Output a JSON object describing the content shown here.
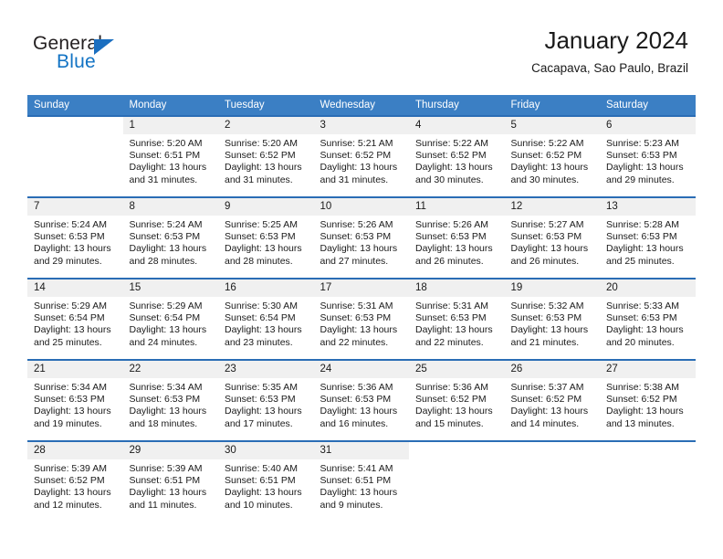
{
  "logo": {
    "word_one": "General",
    "word_two": "Blue",
    "accent_color": "#1273c4",
    "triangle_icon": "triangle-icon"
  },
  "header": {
    "title": "January 2024",
    "subtitle": "Cacapava, Sao Paulo, Brazil"
  },
  "theme": {
    "header_blue": "#3b7fc4",
    "row_border_blue": "#2a6db5",
    "daynum_band": "#f0f0f0"
  },
  "weekdays": [
    "Sunday",
    "Monday",
    "Tuesday",
    "Wednesday",
    "Thursday",
    "Friday",
    "Saturday"
  ],
  "weeks": [
    [
      {
        "day": "",
        "sunrise": "",
        "sunset": "",
        "daylight": ""
      },
      {
        "day": "1",
        "sunrise": "Sunrise: 5:20 AM",
        "sunset": "Sunset: 6:51 PM",
        "daylight": "Daylight: 13 hours and 31 minutes."
      },
      {
        "day": "2",
        "sunrise": "Sunrise: 5:20 AM",
        "sunset": "Sunset: 6:52 PM",
        "daylight": "Daylight: 13 hours and 31 minutes."
      },
      {
        "day": "3",
        "sunrise": "Sunrise: 5:21 AM",
        "sunset": "Sunset: 6:52 PM",
        "daylight": "Daylight: 13 hours and 31 minutes."
      },
      {
        "day": "4",
        "sunrise": "Sunrise: 5:22 AM",
        "sunset": "Sunset: 6:52 PM",
        "daylight": "Daylight: 13 hours and 30 minutes."
      },
      {
        "day": "5",
        "sunrise": "Sunrise: 5:22 AM",
        "sunset": "Sunset: 6:52 PM",
        "daylight": "Daylight: 13 hours and 30 minutes."
      },
      {
        "day": "6",
        "sunrise": "Sunrise: 5:23 AM",
        "sunset": "Sunset: 6:53 PM",
        "daylight": "Daylight: 13 hours and 29 minutes."
      }
    ],
    [
      {
        "day": "7",
        "sunrise": "Sunrise: 5:24 AM",
        "sunset": "Sunset: 6:53 PM",
        "daylight": "Daylight: 13 hours and 29 minutes."
      },
      {
        "day": "8",
        "sunrise": "Sunrise: 5:24 AM",
        "sunset": "Sunset: 6:53 PM",
        "daylight": "Daylight: 13 hours and 28 minutes."
      },
      {
        "day": "9",
        "sunrise": "Sunrise: 5:25 AM",
        "sunset": "Sunset: 6:53 PM",
        "daylight": "Daylight: 13 hours and 28 minutes."
      },
      {
        "day": "10",
        "sunrise": "Sunrise: 5:26 AM",
        "sunset": "Sunset: 6:53 PM",
        "daylight": "Daylight: 13 hours and 27 minutes."
      },
      {
        "day": "11",
        "sunrise": "Sunrise: 5:26 AM",
        "sunset": "Sunset: 6:53 PM",
        "daylight": "Daylight: 13 hours and 26 minutes."
      },
      {
        "day": "12",
        "sunrise": "Sunrise: 5:27 AM",
        "sunset": "Sunset: 6:53 PM",
        "daylight": "Daylight: 13 hours and 26 minutes."
      },
      {
        "day": "13",
        "sunrise": "Sunrise: 5:28 AM",
        "sunset": "Sunset: 6:53 PM",
        "daylight": "Daylight: 13 hours and 25 minutes."
      }
    ],
    [
      {
        "day": "14",
        "sunrise": "Sunrise: 5:29 AM",
        "sunset": "Sunset: 6:54 PM",
        "daylight": "Daylight: 13 hours and 25 minutes."
      },
      {
        "day": "15",
        "sunrise": "Sunrise: 5:29 AM",
        "sunset": "Sunset: 6:54 PM",
        "daylight": "Daylight: 13 hours and 24 minutes."
      },
      {
        "day": "16",
        "sunrise": "Sunrise: 5:30 AM",
        "sunset": "Sunset: 6:54 PM",
        "daylight": "Daylight: 13 hours and 23 minutes."
      },
      {
        "day": "17",
        "sunrise": "Sunrise: 5:31 AM",
        "sunset": "Sunset: 6:53 PM",
        "daylight": "Daylight: 13 hours and 22 minutes."
      },
      {
        "day": "18",
        "sunrise": "Sunrise: 5:31 AM",
        "sunset": "Sunset: 6:53 PM",
        "daylight": "Daylight: 13 hours and 22 minutes."
      },
      {
        "day": "19",
        "sunrise": "Sunrise: 5:32 AM",
        "sunset": "Sunset: 6:53 PM",
        "daylight": "Daylight: 13 hours and 21 minutes."
      },
      {
        "day": "20",
        "sunrise": "Sunrise: 5:33 AM",
        "sunset": "Sunset: 6:53 PM",
        "daylight": "Daylight: 13 hours and 20 minutes."
      }
    ],
    [
      {
        "day": "21",
        "sunrise": "Sunrise: 5:34 AM",
        "sunset": "Sunset: 6:53 PM",
        "daylight": "Daylight: 13 hours and 19 minutes."
      },
      {
        "day": "22",
        "sunrise": "Sunrise: 5:34 AM",
        "sunset": "Sunset: 6:53 PM",
        "daylight": "Daylight: 13 hours and 18 minutes."
      },
      {
        "day": "23",
        "sunrise": "Sunrise: 5:35 AM",
        "sunset": "Sunset: 6:53 PM",
        "daylight": "Daylight: 13 hours and 17 minutes."
      },
      {
        "day": "24",
        "sunrise": "Sunrise: 5:36 AM",
        "sunset": "Sunset: 6:53 PM",
        "daylight": "Daylight: 13 hours and 16 minutes."
      },
      {
        "day": "25",
        "sunrise": "Sunrise: 5:36 AM",
        "sunset": "Sunset: 6:52 PM",
        "daylight": "Daylight: 13 hours and 15 minutes."
      },
      {
        "day": "26",
        "sunrise": "Sunrise: 5:37 AM",
        "sunset": "Sunset: 6:52 PM",
        "daylight": "Daylight: 13 hours and 14 minutes."
      },
      {
        "day": "27",
        "sunrise": "Sunrise: 5:38 AM",
        "sunset": "Sunset: 6:52 PM",
        "daylight": "Daylight: 13 hours and 13 minutes."
      }
    ],
    [
      {
        "day": "28",
        "sunrise": "Sunrise: 5:39 AM",
        "sunset": "Sunset: 6:52 PM",
        "daylight": "Daylight: 13 hours and 12 minutes."
      },
      {
        "day": "29",
        "sunrise": "Sunrise: 5:39 AM",
        "sunset": "Sunset: 6:51 PM",
        "daylight": "Daylight: 13 hours and 11 minutes."
      },
      {
        "day": "30",
        "sunrise": "Sunrise: 5:40 AM",
        "sunset": "Sunset: 6:51 PM",
        "daylight": "Daylight: 13 hours and 10 minutes."
      },
      {
        "day": "31",
        "sunrise": "Sunrise: 5:41 AM",
        "sunset": "Sunset: 6:51 PM",
        "daylight": "Daylight: 13 hours and 9 minutes."
      },
      {
        "day": "",
        "sunrise": "",
        "sunset": "",
        "daylight": ""
      },
      {
        "day": "",
        "sunrise": "",
        "sunset": "",
        "daylight": ""
      },
      {
        "day": "",
        "sunrise": "",
        "sunset": "",
        "daylight": ""
      }
    ]
  ]
}
